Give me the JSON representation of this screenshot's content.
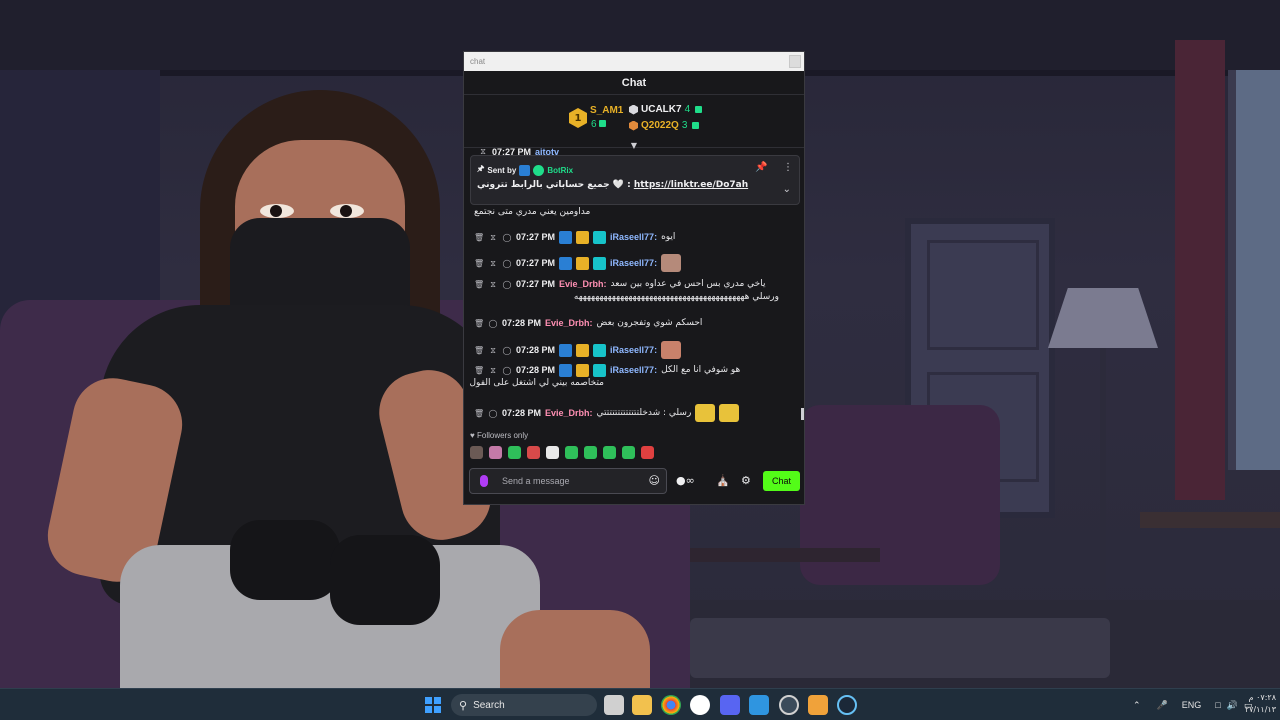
{
  "window": {
    "title": "chat"
  },
  "chat": {
    "header": "Chat",
    "leaderboard": {
      "first": {
        "rank": "1",
        "name": "S_AM1",
        "count": "6"
      },
      "second": {
        "name": "UCALK7",
        "count": "4"
      },
      "third": {
        "name": "Q2022Q",
        "count": "3"
      }
    },
    "pinned": {
      "sent_by": "Sent by",
      "bot_name": "BotRix",
      "message_prefix": "جميع حساباتي بالرابط تتروني 🤍 :",
      "link": "https://linktr.ee/Do7ah"
    },
    "partial_message": {
      "time": "07:27 PM",
      "username": "aitotv"
    },
    "messages": [
      {
        "time": "",
        "username": "",
        "text": "مداومين يعني مدري متى نجتمع"
      },
      {
        "time": "07:27 PM",
        "username": "iRaseell77:",
        "text": "ايوه"
      },
      {
        "time": "07:27 PM",
        "username": "iRaseell77:",
        "text": ""
      },
      {
        "time": "07:27 PM",
        "username": "Evie_Drbh:",
        "text": "ياخي مدري بس احس في عداوه بين سعد",
        "text2": "ورسلي هههههههههههههههههههههههههههههههههههههههههه"
      },
      {
        "time": "07:28 PM",
        "username": "Evie_Drbh:",
        "text": "احسكم شوي وتفجرون بعض"
      },
      {
        "time": "07:28 PM",
        "username": "iRaseell77:",
        "text": ""
      },
      {
        "time": "07:28 PM",
        "username": "iRaseell77:",
        "text": "هو شوفي انا مع الكل",
        "text2": "متخاصمه بيني لي اشتغل على الفول"
      },
      {
        "time": "07:28 PM",
        "username": "Evie_Drbh:",
        "text": "رسلي : شدخلتتتتتتتتتتتتتي"
      }
    ],
    "followers_only": "Followers only",
    "input": {
      "placeholder": "Send a message"
    },
    "send_label": "Chat"
  },
  "taskbar": {
    "search_label": "Search",
    "language": "ENG",
    "time": "٠٧:٢٨ م",
    "date": "٢٧/١١/١٣"
  },
  "colors": {
    "accent": "#53fc18",
    "gold": "#e8b127",
    "gem": "#1fdd8a",
    "username_blue": "#8fb8ff",
    "username_pink": "#ff8fb3"
  }
}
